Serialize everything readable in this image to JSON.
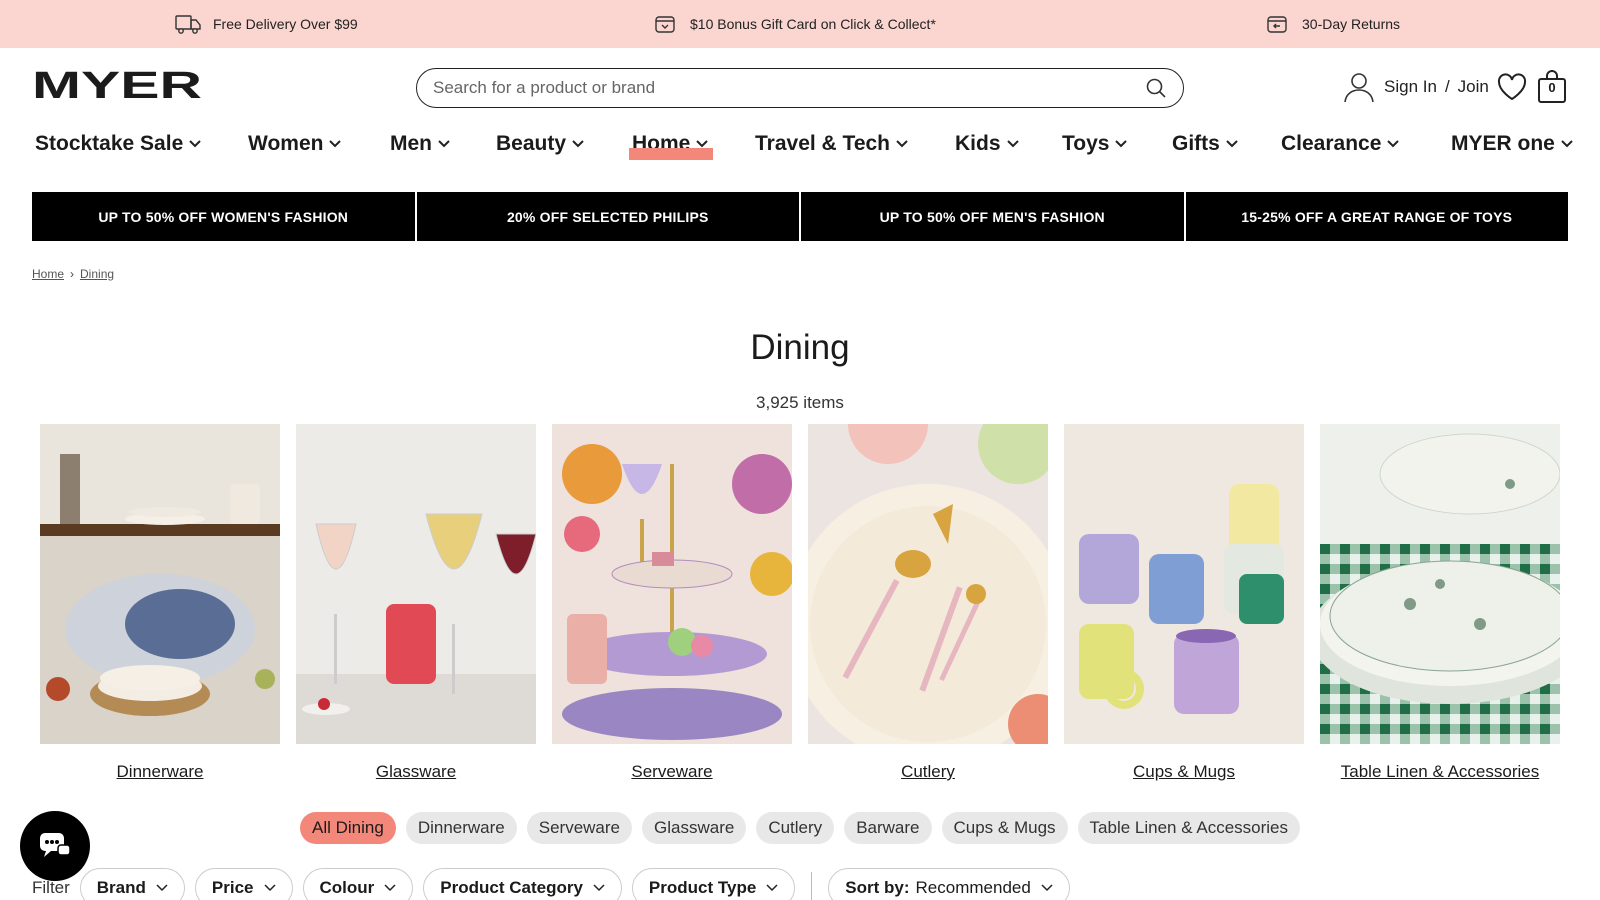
{
  "promo": [
    {
      "icon": "truck-icon",
      "text": "Free Delivery Over $99"
    },
    {
      "icon": "gift-card-icon",
      "text": "$10 Bonus Gift Card on Click & Collect*"
    },
    {
      "icon": "returns-icon",
      "text": "30-Day Returns"
    }
  ],
  "brand": {
    "logo_text": "MYER",
    "accent": "#f3877a",
    "promo_bg": "#fbd6d0"
  },
  "search": {
    "placeholder": "Search for a product or brand"
  },
  "account": {
    "sign_in": "Sign In",
    "separator": "/",
    "join": "Join",
    "bag_count": "0"
  },
  "nav": [
    {
      "label": "Stocktake Sale"
    },
    {
      "label": "Women"
    },
    {
      "label": "Men"
    },
    {
      "label": "Beauty"
    },
    {
      "label": "Home"
    },
    {
      "label": "Travel & Tech"
    },
    {
      "label": "Kids"
    },
    {
      "label": "Toys"
    },
    {
      "label": "Gifts"
    },
    {
      "label": "Clearance"
    },
    {
      "label": "MYER one"
    }
  ],
  "nav_active": "Home",
  "banners": [
    "UP TO 50% OFF WOMEN'S FASHION",
    "20% OFF SELECTED PHILIPS",
    "UP TO 50% OFF MEN'S FASHION",
    "15-25% OFF A GREAT RANGE OF TOYS"
  ],
  "breadcrumb": {
    "home": "Home",
    "sep": "›",
    "current": "Dining"
  },
  "page": {
    "title": "Dining",
    "count": "3,925 items"
  },
  "categories": [
    {
      "label": "Dinnerware"
    },
    {
      "label": "Glassware"
    },
    {
      "label": "Serveware"
    },
    {
      "label": "Cutlery"
    },
    {
      "label": "Cups & Mugs"
    },
    {
      "label": "Table Linen & Accessories"
    }
  ],
  "chips": [
    {
      "label": "All Dining",
      "active": true
    },
    {
      "label": "Dinnerware"
    },
    {
      "label": "Serveware"
    },
    {
      "label": "Glassware"
    },
    {
      "label": "Cutlery"
    },
    {
      "label": "Barware"
    },
    {
      "label": "Cups & Mugs"
    },
    {
      "label": "Table Linen & Accessories"
    }
  ],
  "filters": {
    "label": "Filter",
    "buttons": [
      "Brand",
      "Price",
      "Colour",
      "Product Category",
      "Product Type"
    ],
    "sort_label": "Sort by:",
    "sort_value": "Recommended"
  }
}
